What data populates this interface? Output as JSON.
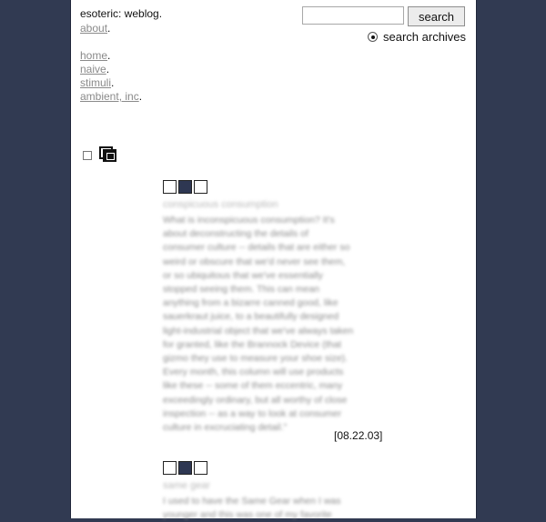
{
  "site": {
    "title": "esoteric: weblog.",
    "about_label": "about",
    "dot": "."
  },
  "nav": [
    {
      "label": "home"
    },
    {
      "label": "naive"
    },
    {
      "label": "stimuli"
    },
    {
      "label": "ambient, inc"
    }
  ],
  "search": {
    "button_label": "search",
    "input_value": "",
    "radio_label": "search archives"
  },
  "posts": [
    {
      "title": "conspicuous consumption",
      "body": "What is inconspicuous consumption? It's\nabout deconstructing the details of\nconsumer culture -- details that are either so\nweird or obscure that we'd never see them,\nor so ubiquitous that we've essentially\nstopped seeing them. This can mean\nanything from a bizarre canned good, like\nsauerkraut juice, to a beautifully designed\nlight-industrial object that we've always taken\nfor granted, like the Brannock Device (that\ngizmo they use to measure your shoe size).\nEvery month, this column will use products\nlike these -- some of them eccentric, many\nexceedingly ordinary, but all worthy of close\ninspection -- as a way to look at consumer\nculture in excruciating detail.\"",
      "date": "[08.22.03]"
    },
    {
      "title": "same gear",
      "body": "I used to have the Same Gear when I was\nyounger and this was one of my favorite",
      "date": ""
    }
  ],
  "colors": {
    "background": "#313a52",
    "accent": "#2e3752",
    "link": "#8a8a8a"
  }
}
